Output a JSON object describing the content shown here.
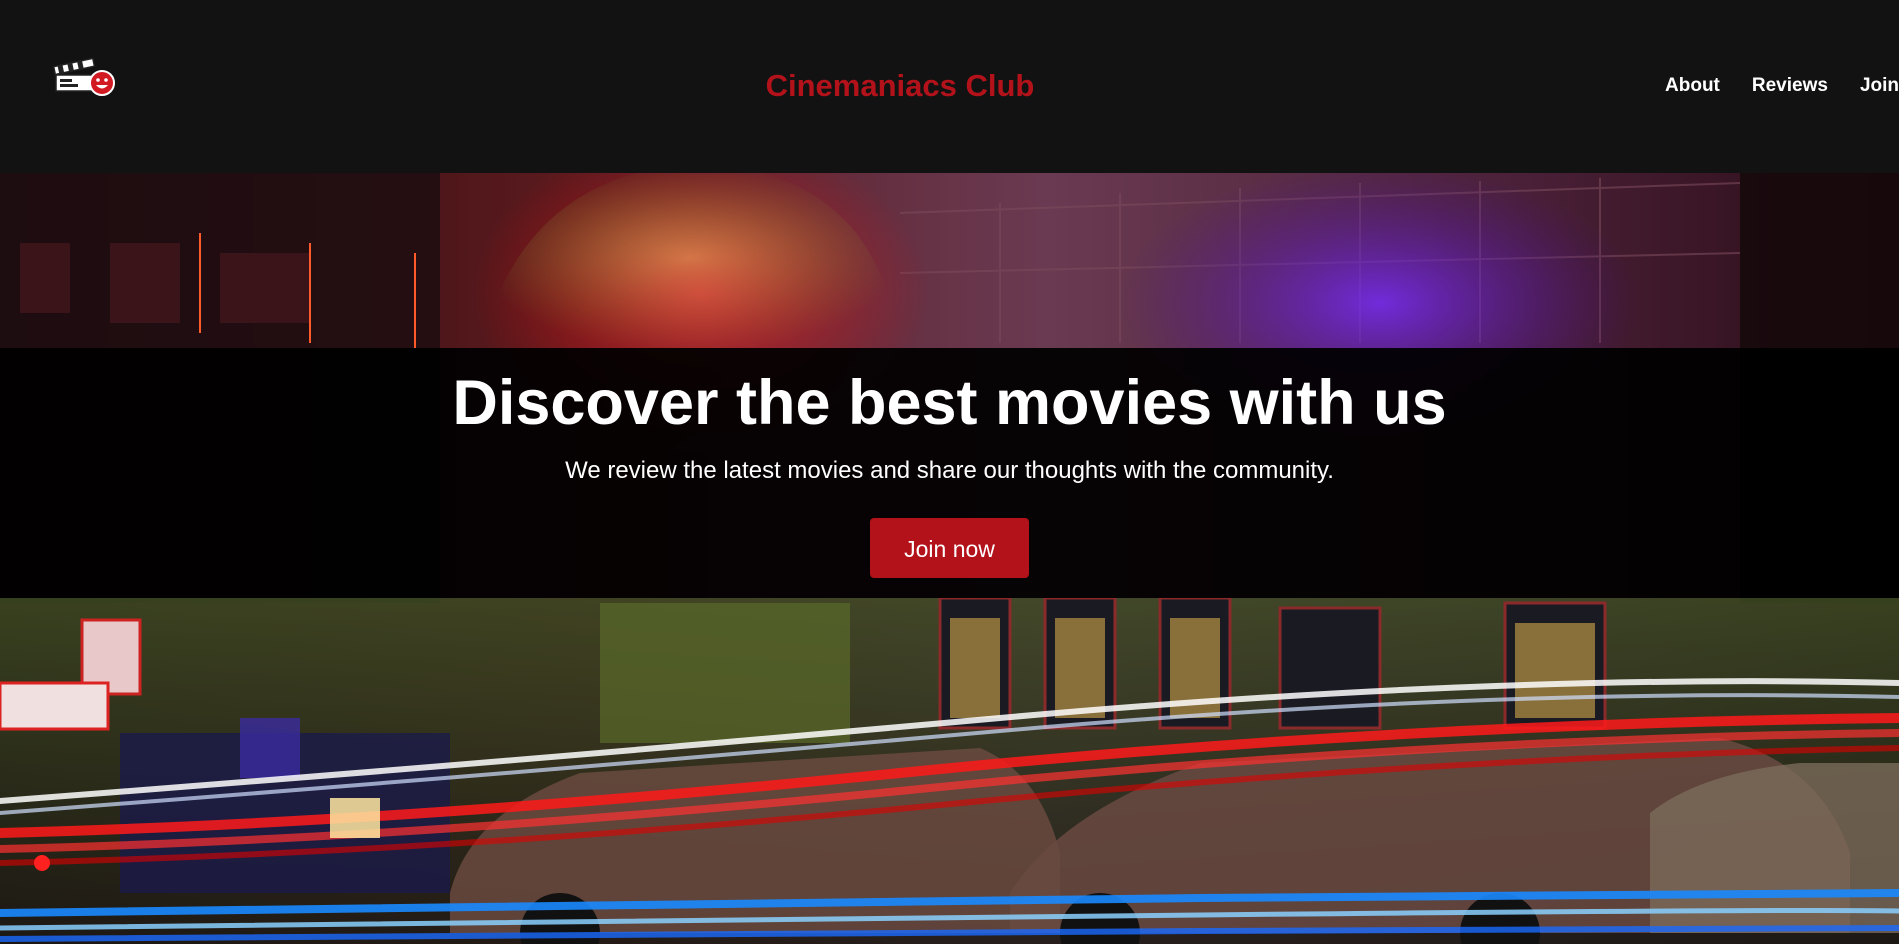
{
  "header": {
    "logo_icon": "clapperboard-smiley-icon",
    "title": "Cinemaniacs Club",
    "nav": [
      {
        "label": "About"
      },
      {
        "label": "Reviews"
      },
      {
        "label": "Join"
      }
    ]
  },
  "hero": {
    "background_image": "night-street-cinema-photo",
    "headline": "Discover the best movies with us",
    "subheadline": "We review the latest movies and share our thoughts with the community.",
    "cta_label": "Join now"
  },
  "colors": {
    "header_bg": "#121212",
    "accent": "#b3121b",
    "text": "#ffffff"
  }
}
